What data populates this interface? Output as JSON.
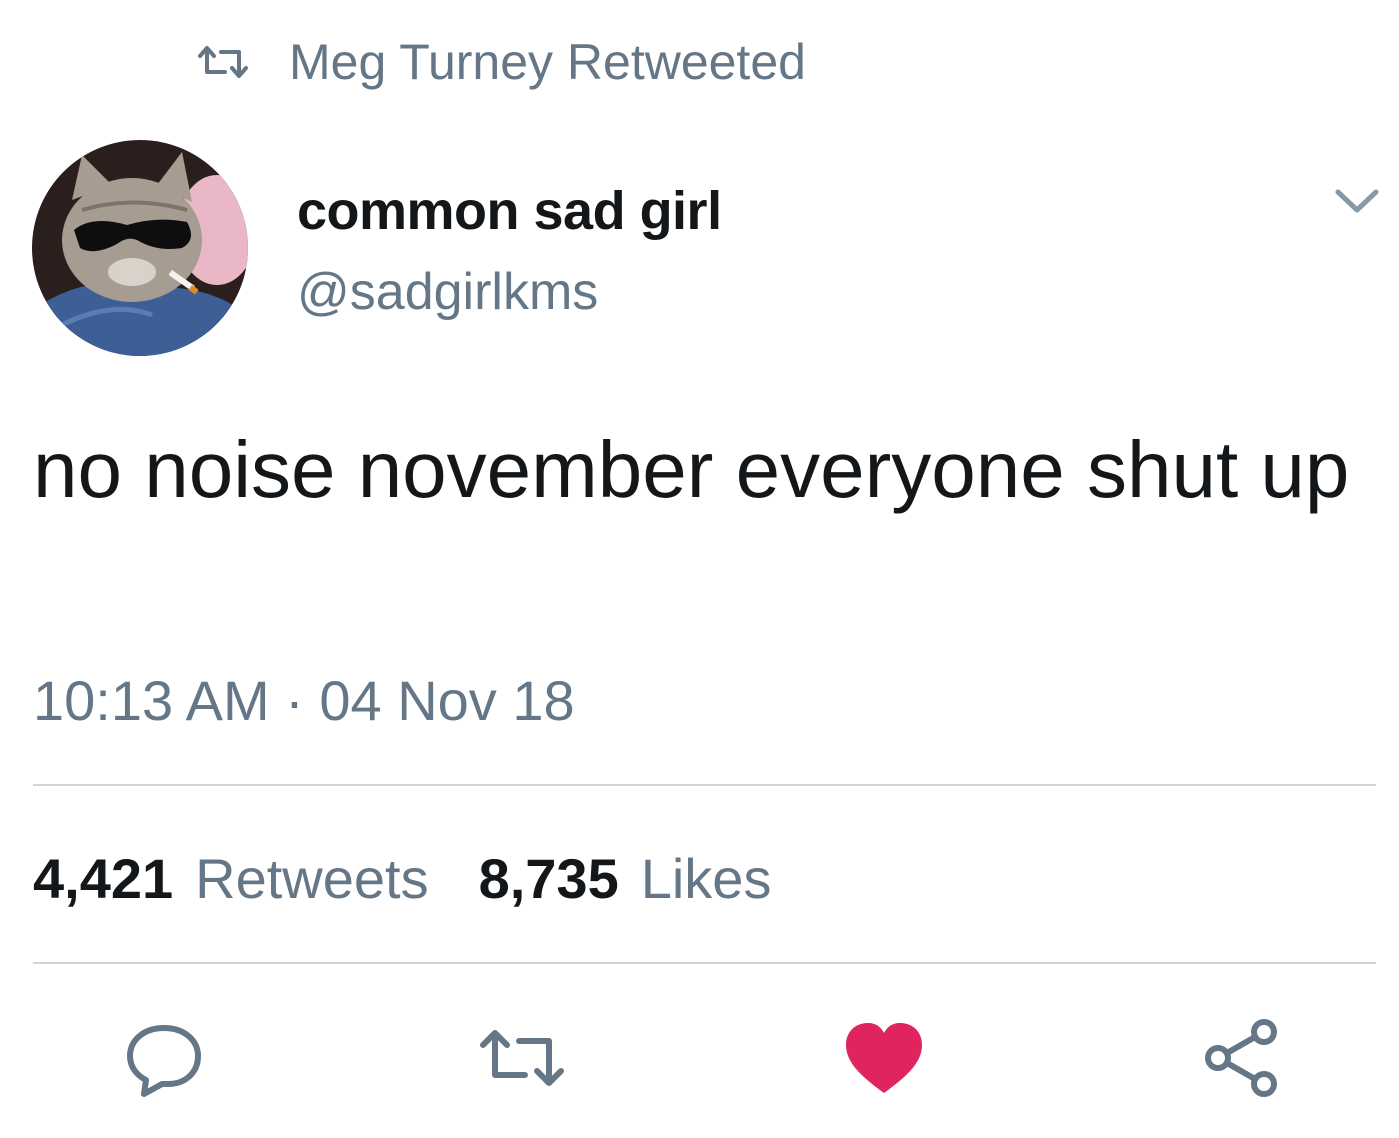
{
  "retweet_context": {
    "icon": "retweet-icon",
    "text": "Meg Turney Retweeted"
  },
  "author": {
    "display_name": "common sad girl",
    "handle": "@sadgirlkms",
    "avatar": "avatar-cat-sunglasses"
  },
  "tweet": {
    "text": "no noise november everyone shut up",
    "timestamp": "10:13 AM · 04 Nov 18"
  },
  "stats": {
    "retweets_count": "4,421",
    "retweets_label": "Retweets",
    "likes_count": "8,735",
    "likes_label": "Likes"
  },
  "actions": {
    "reply_icon": "reply-icon",
    "retweet_icon": "retweet-icon",
    "like_icon": "heart-icon",
    "share_icon": "share-icon"
  },
  "colors": {
    "text_primary": "#14171a",
    "text_secondary": "#657786",
    "divider": "#ccd6dd",
    "liked_heart": "#e0245e"
  }
}
